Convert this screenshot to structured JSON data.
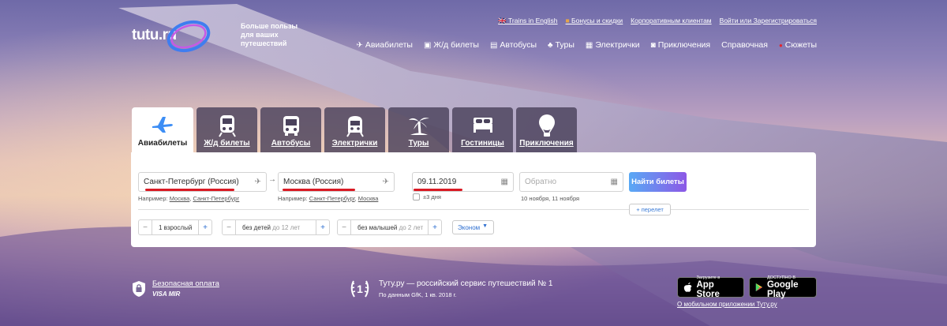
{
  "brand": {
    "logo": "tutu.ru",
    "slogan": "Больше пользы для ваших путешествий"
  },
  "top_links": [
    "Trains in English",
    "Бонусы и скидки",
    "Корпоративным клиентам",
    "Войти или Зарегистрироваться"
  ],
  "nav": [
    {
      "label": "Авиабилеты",
      "icon": "plane-icon"
    },
    {
      "label": "Ж/д билеты",
      "icon": "train-icon"
    },
    {
      "label": "Автобусы",
      "icon": "bus-icon"
    },
    {
      "label": "Туры",
      "icon": "palm-icon"
    },
    {
      "label": "Электрички",
      "icon": "suburban-train-icon"
    },
    {
      "label": "Приключения",
      "icon": "camera-icon"
    },
    {
      "label": "Справочная",
      "icon": ""
    },
    {
      "label": "Сюжеты",
      "icon": "red-dot-icon"
    }
  ],
  "tabs": [
    {
      "label": "Авиабилеты",
      "icon": "plane-icon",
      "active": true
    },
    {
      "label": "Ж/д билеты",
      "icon": "train-icon"
    },
    {
      "label": "Автобусы",
      "icon": "bus-icon"
    },
    {
      "label": "Электрички",
      "icon": "suburban-train-icon"
    },
    {
      "label": "Туры",
      "icon": "palm-icon"
    },
    {
      "label": "Гостиницы",
      "icon": "bed-icon"
    },
    {
      "label": "Приключения",
      "icon": "balloon-icon"
    }
  ],
  "search": {
    "from": {
      "value": "Санкт-Петербург (Россия)",
      "hint_prefix": "Например:",
      "hint_links": [
        "Москва",
        "Санкт-Петербург"
      ]
    },
    "to": {
      "value": "Москва (Россия)",
      "hint_prefix": "Например:",
      "hint_links": [
        "Санкт-Петербург",
        "Москва"
      ]
    },
    "date": {
      "value": "09.11.2019",
      "flex_label": "±3 дня"
    },
    "return": {
      "placeholder": "Обратно",
      "hint": "10 ноября, 11 ноября"
    },
    "submit": "Найти билеты",
    "add_flight": "+ перелет",
    "passengers": {
      "adults": "1 взрослый",
      "children": "без детей",
      "children_note": "до 12 лет",
      "infants": "без малышей",
      "infants_note": "до 2 лет"
    },
    "class": "Эконом"
  },
  "footer": {
    "secure": "Безопасная оплата",
    "cards": "VISA MIR",
    "award_title": "Туту.ру — российский сервис путешествий № 1",
    "award_note": "По данным GfK, 1 кв. 2018 г.",
    "app_store_small": "Загрузите в",
    "app_store": "App Store",
    "google_small": "ДОСТУПНО В",
    "google": "Google Play",
    "mobile_link": "О мобильном приложении Туту.ру"
  },
  "colors": {
    "accent": "#d91a24",
    "button_from": "#59a9f5",
    "button_to": "#8c58e6",
    "link": "#2e6fd0"
  }
}
